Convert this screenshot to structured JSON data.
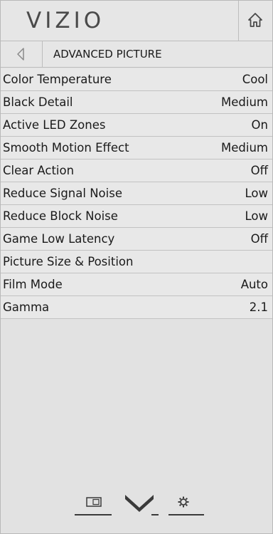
{
  "header": {
    "logo": "VIZIO",
    "home_icon": "home-icon"
  },
  "sub_header": {
    "back_icon": "back-arrow-icon",
    "title": "ADVANCED PICTURE"
  },
  "menu": {
    "items": [
      {
        "label": "Color Temperature",
        "value": "Cool"
      },
      {
        "label": "Black Detail",
        "value": "Medium"
      },
      {
        "label": "Active LED Zones",
        "value": "On"
      },
      {
        "label": "Smooth Motion Effect",
        "value": "Medium"
      },
      {
        "label": "Clear Action",
        "value": "Off"
      },
      {
        "label": "Reduce Signal Noise",
        "value": "Low"
      },
      {
        "label": "Reduce Block Noise",
        "value": "Low"
      },
      {
        "label": "Game Low Latency",
        "value": "Off"
      },
      {
        "label": "Picture Size & Position",
        "value": ""
      },
      {
        "label": "Film Mode",
        "value": "Auto"
      },
      {
        "label": "Gamma",
        "value": "2.1"
      }
    ]
  },
  "footer": {
    "icons": [
      "input-icon",
      "vizio-v-icon",
      "settings-icon"
    ]
  },
  "colors": {
    "background": "#e2e2e2",
    "text": "#1a1a1a",
    "logo": "#4a4a4a"
  }
}
